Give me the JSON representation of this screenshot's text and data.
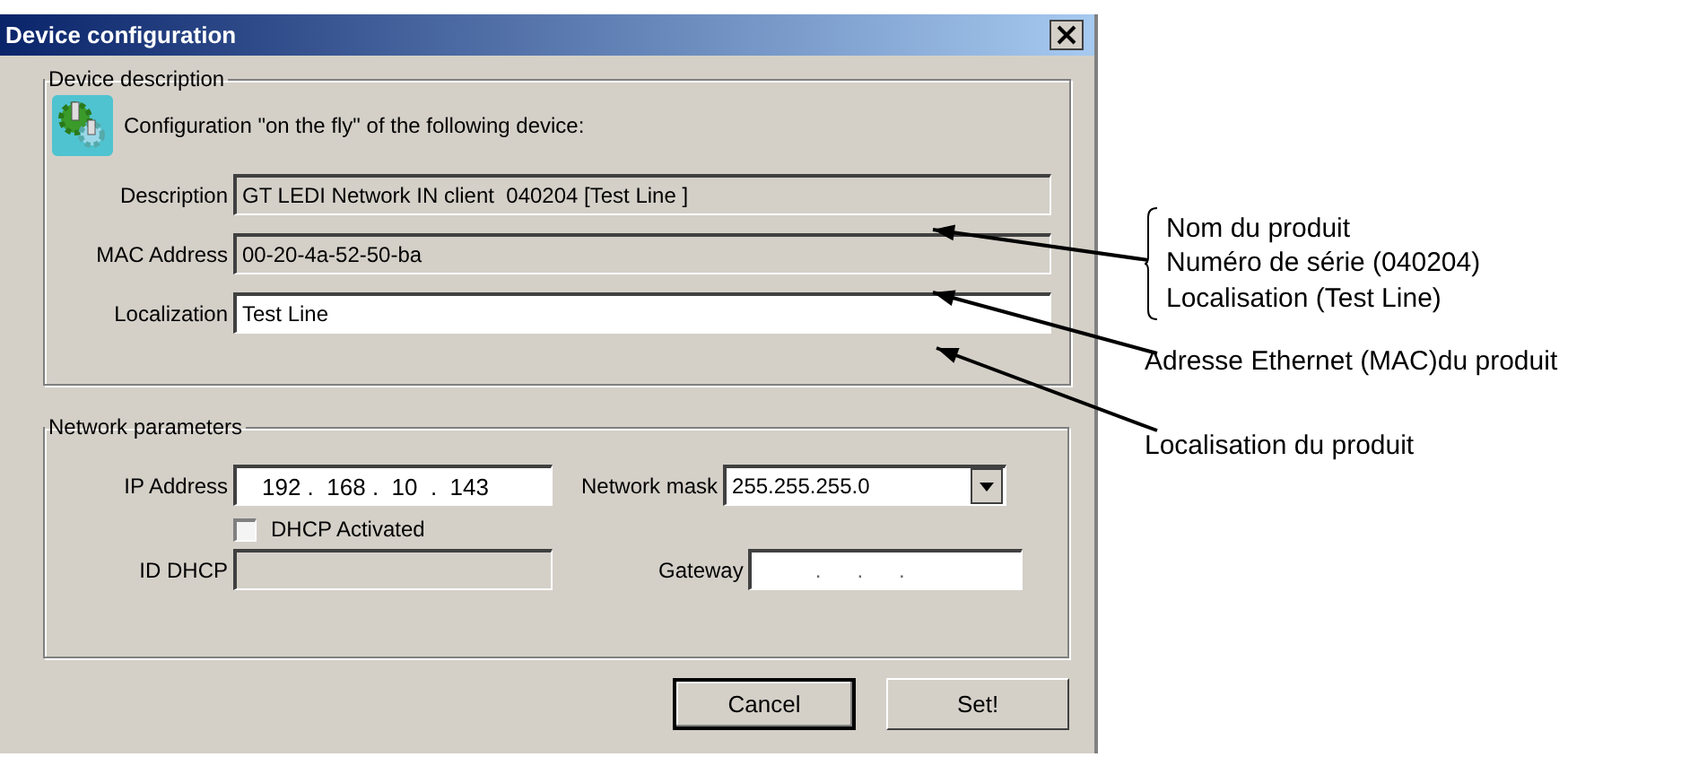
{
  "window": {
    "title": "Device configuration"
  },
  "device_description": {
    "legend": "Device description",
    "intro": "Configuration \"on the fly\" of the following device:",
    "fields": [
      {
        "label": "Description",
        "value": "GT LEDI Network IN client  040204 [Test Line ]",
        "disabled": true
      },
      {
        "label": "MAC Address",
        "value": "00-20-4a-52-50-ba",
        "disabled": true
      },
      {
        "label": "Localization",
        "value": "Test Line",
        "disabled": false
      }
    ]
  },
  "network_parameters": {
    "legend": "Network parameters",
    "ip_address": {
      "label": "IP Address",
      "value": "192 .  168 .  10  .  143"
    },
    "network_mask": {
      "label": "Network mask",
      "value": "255.255.255.0"
    },
    "dhcp": {
      "label": "DHCP Activated",
      "checked": false
    },
    "id_dhcp": {
      "label": "ID DHCP",
      "disabled": true
    },
    "gateway": {
      "label": "Gateway",
      "value": ".      .      ."
    }
  },
  "buttons": [
    {
      "label": "Cancel",
      "default": true
    },
    {
      "label": "Set!",
      "default": false
    }
  ],
  "annotations": [
    {
      "lines": [
        "Nom du produit",
        "Numéro de série (040204)",
        "Localisation (Test Line)"
      ],
      "bracket": true
    },
    {
      "lines": [
        "Adresse Ethernet (MAC)du produit"
      ],
      "bracket": false
    },
    {
      "lines": [
        "Localisation du produit"
      ],
      "bracket": false
    }
  ]
}
